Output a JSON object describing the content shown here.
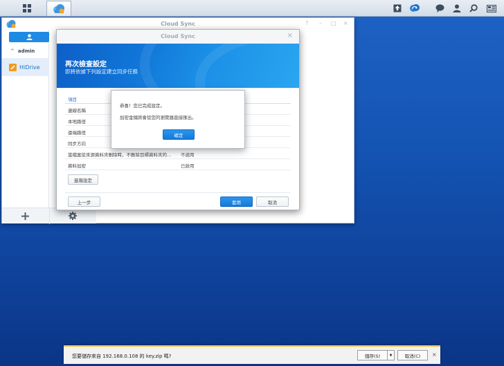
{
  "colors": {
    "desktop": "#1352b0",
    "accent": "#1f8ae4",
    "banner": "#1177d8",
    "download_bar_border": "#f6c22b"
  },
  "taskbar": {
    "left_icons": [
      "main-menu-icon",
      "cloud-sync-app-icon"
    ],
    "right_icons": [
      "upload-icon",
      "sync-status-icon",
      "chat-icon",
      "user-icon",
      "search-icon",
      "widgets-icon"
    ]
  },
  "main_window": {
    "title": "Cloud Sync",
    "controls": [
      "?",
      "–",
      "□",
      "×"
    ],
    "sidebar": {
      "user_label": "admin",
      "items": [
        {
          "label": "HiDrive",
          "icon": "hidrive-icon"
        }
      ]
    },
    "bottom_icons": [
      "add-icon",
      "gear-icon"
    ]
  },
  "wizard": {
    "title": "Cloud Sync",
    "heading": "再次檢查設定",
    "subheading": "即將依據下列設定建立同步任務",
    "summary": {
      "header": {
        "key": "項目",
        "value": ""
      },
      "rows": [
        {
          "key": "連線名稱",
          "value": ""
        },
        {
          "key": "本地路徑",
          "value": ""
        },
        {
          "key": "遠端路徑",
          "value": ""
        },
        {
          "key": "同步方向",
          "value": ""
        },
        {
          "key": "當檔案從來源資料夾刪除時，不刪除目標資料夾的...",
          "value": "不適用"
        },
        {
          "key": "資料加密",
          "value": "已啟用"
        }
      ]
    },
    "advanced_label": "進階設定",
    "back_label": "上一步",
    "apply_label": "套用",
    "cancel_label": "取消"
  },
  "message_box": {
    "line1": "恭喜！您已完成設定。",
    "line2": "加密金鑰將會從您的瀏覽器直接匯出。",
    "ok_label": "確定"
  },
  "download_bar": {
    "text": "您要儲存來自 192.168.0.108 的 key.zip 嗎?",
    "save_label": "儲存(S)",
    "cancel_label": "取消(C)",
    "close": "×"
  }
}
